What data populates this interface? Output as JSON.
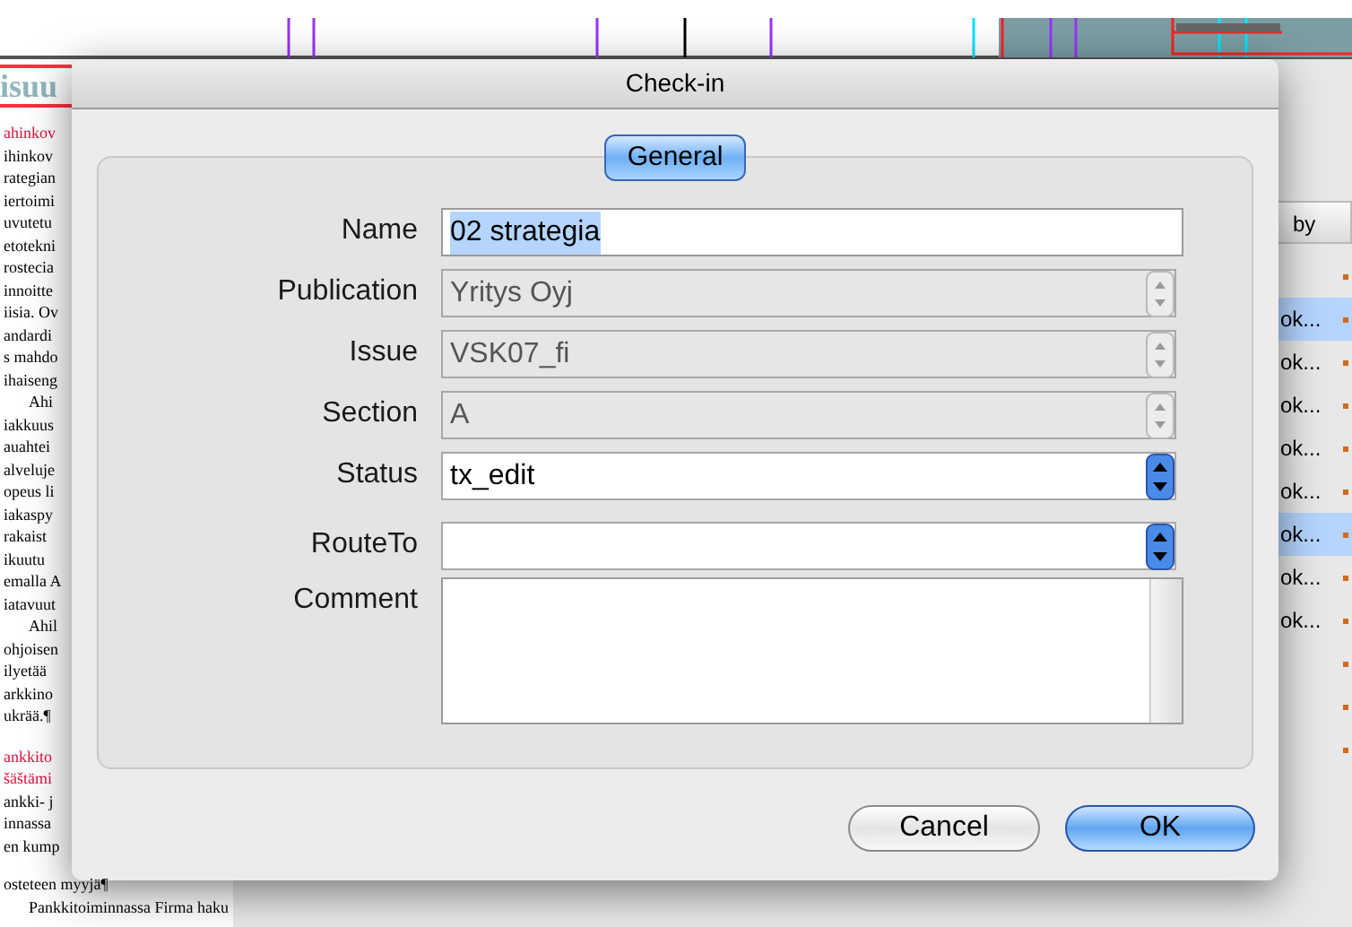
{
  "document": {
    "heading": "isuu",
    "lines": [
      {
        "text": "ahinkov",
        "kind": "red"
      },
      {
        "text": "ihinkov",
        "kind": "body"
      },
      {
        "text": "rategian",
        "kind": "body"
      },
      {
        "text": "iertoimi",
        "kind": "body"
      },
      {
        "text": "uvutetu",
        "kind": "body"
      },
      {
        "text": "etotekni",
        "kind": "body"
      },
      {
        "text": "rostecia",
        "kind": "body"
      },
      {
        "text": "innoitte",
        "kind": "body"
      },
      {
        "text": "iisia. Ov",
        "kind": "body"
      },
      {
        "text": "andardi",
        "kind": "body"
      },
      {
        "text": "s mahdo",
        "kind": "body"
      },
      {
        "text": "ihaiseng",
        "kind": "body"
      },
      {
        "text": "Ahi",
        "kind": "indent"
      },
      {
        "text": "iakkuus",
        "kind": "body"
      },
      {
        "text": "auahtei",
        "kind": "body"
      },
      {
        "text": "alveluje",
        "kind": "body"
      },
      {
        "text": "opeus li",
        "kind": "body"
      },
      {
        "text": "iakaspy",
        "kind": "body"
      },
      {
        "text": "rakaist",
        "kind": "body"
      },
      {
        "text": "ikuutu",
        "kind": "body"
      },
      {
        "text": "emalla A",
        "kind": "body"
      },
      {
        "text": "iatavuut",
        "kind": "body"
      },
      {
        "text": "Ahil",
        "kind": "indent"
      },
      {
        "text": "ohjoisen",
        "kind": "body"
      },
      {
        "text": "ilyetää",
        "kind": "body"
      },
      {
        "text": "arkkino",
        "kind": "body"
      },
      {
        "text": "ukrää.¶",
        "kind": "body"
      },
      {
        "text": "ankkito",
        "kind": "red"
      },
      {
        "text": "šäštämi",
        "kind": "red"
      },
      {
        "text": "ankki- j",
        "kind": "body"
      },
      {
        "text": "innassa",
        "kind": "body"
      },
      {
        "text": "en kump",
        "kind": "body"
      }
    ],
    "footer_lines": [
      {
        "text": "osteteen myyjä¶",
        "kind": "body"
      },
      {
        "text": "Pankkitoiminnassa Firma haku",
        "kind": "indent"
      }
    ]
  },
  "list": {
    "column_header": "by",
    "rows": [
      {
        "text": "",
        "selected": false
      },
      {
        "text": "ok...",
        "selected": true
      },
      {
        "text": "ok...",
        "selected": false
      },
      {
        "text": "ok...",
        "selected": false
      },
      {
        "text": "ok...",
        "selected": false
      },
      {
        "text": "ok...",
        "selected": false
      },
      {
        "text": "ok...",
        "selected": true
      },
      {
        "text": "ok...",
        "selected": false
      },
      {
        "text": "ok...",
        "selected": false
      },
      {
        "text": "",
        "selected": false
      },
      {
        "text": "",
        "selected": false
      },
      {
        "text": "",
        "selected": false
      }
    ]
  },
  "dialog": {
    "title": "Check-in",
    "tabs": [
      {
        "label": "General",
        "selected": true
      }
    ],
    "fields": [
      {
        "label": "Name",
        "kind": "text",
        "value": "02 strategia",
        "disabled": false
      },
      {
        "label": "Publication",
        "kind": "popup",
        "value": "Yritys Oyj",
        "disabled": true
      },
      {
        "label": "Issue",
        "kind": "popup",
        "value": "VSK07_fi",
        "disabled": true
      },
      {
        "label": "Section",
        "kind": "popup",
        "value": "A",
        "disabled": true
      },
      {
        "label": "Status",
        "kind": "popup",
        "value": "tx_edit",
        "disabled": false
      },
      {
        "label": "RouteTo",
        "kind": "popup",
        "disabled": false
      },
      {
        "label": "Comment",
        "kind": "textarea",
        "disabled": false
      }
    ],
    "buttons": [
      {
        "label": "Cancel",
        "default": false
      },
      {
        "label": "OK",
        "default": true
      }
    ]
  }
}
